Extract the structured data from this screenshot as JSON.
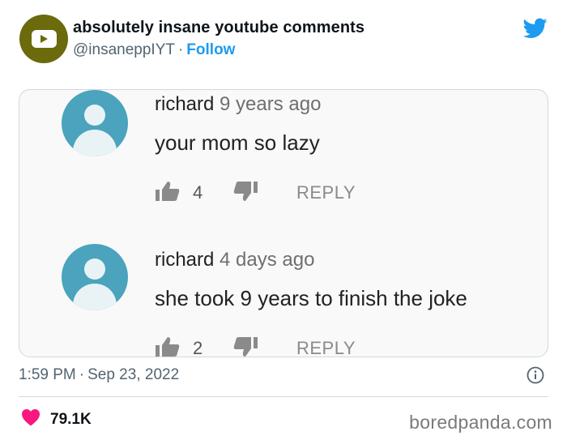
{
  "header": {
    "name": "absolutely insane youtube comments",
    "handle": "@insaneppIYT",
    "separator": "·",
    "follow_label": "Follow"
  },
  "comments": [
    {
      "author": "richard",
      "age": "9 years ago",
      "text": "your mom so lazy",
      "likes": "4",
      "reply_label": "REPLY"
    },
    {
      "author": "richard",
      "age": "4 days ago",
      "text": "she took 9 years to finish the joke",
      "likes": "2",
      "reply_label": "REPLY"
    }
  ],
  "footer": {
    "time": "1:59 PM",
    "separator": "·",
    "date": "Sep 23, 2022",
    "like_count": "79.1K",
    "watermark": "boredpanda.com"
  },
  "icons": {
    "avatar": "youtube-logo-icon",
    "platform": "twitter-bird-icon",
    "info": "info-icon",
    "heart": "heart-icon",
    "like": "thumbs-up-icon",
    "dislike": "thumbs-down-icon"
  },
  "colors": {
    "avatar_bg": "#6b6a0c",
    "follow": "#1d9bf0",
    "twitter": "#1d9bf0",
    "heart": "#f91880",
    "comment_avatar": "#4ba3bd"
  }
}
